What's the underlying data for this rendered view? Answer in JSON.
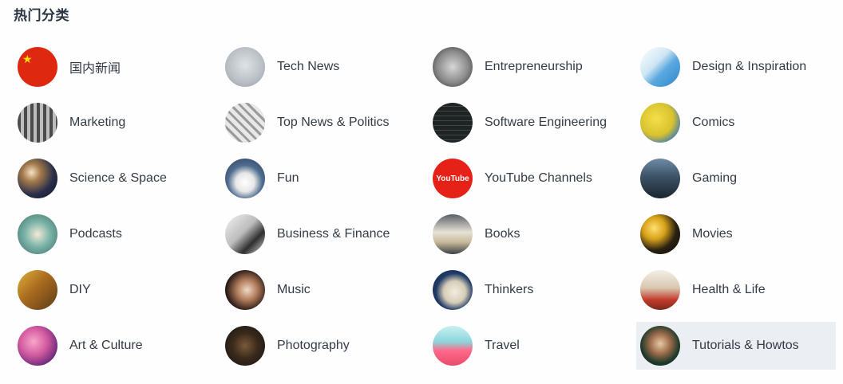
{
  "section_title": "热门分类",
  "categories": [
    {
      "label": "国内新闻",
      "icon": "china-flag-icon"
    },
    {
      "label": "Tech News",
      "icon": "robot-icon"
    },
    {
      "label": "Entrepreneurship",
      "icon": "mug-icon"
    },
    {
      "label": "Design & Inspiration",
      "icon": "design-icon"
    },
    {
      "label": "Marketing",
      "icon": "typewriter-icon"
    },
    {
      "label": "Top News & Politics",
      "icon": "newspaper-icon"
    },
    {
      "label": "Software Engineering",
      "icon": "code-icon"
    },
    {
      "label": "Comics",
      "icon": "comic-icon"
    },
    {
      "label": "Science & Space",
      "icon": "telescope-icon"
    },
    {
      "label": "Fun",
      "icon": "cat-icon"
    },
    {
      "label": "YouTube Channels",
      "icon": "youtube-icon"
    },
    {
      "label": "Gaming",
      "icon": "controller-icon"
    },
    {
      "label": "Podcasts",
      "icon": "microphone-icon"
    },
    {
      "label": "Business & Finance",
      "icon": "briefcase-icon"
    },
    {
      "label": "Books",
      "icon": "book-icon"
    },
    {
      "label": "Movies",
      "icon": "film-reel-icon"
    },
    {
      "label": "DIY",
      "icon": "tools-icon"
    },
    {
      "label": "Music",
      "icon": "headphones-icon"
    },
    {
      "label": "Thinkers",
      "icon": "statue-icon"
    },
    {
      "label": "Health & Life",
      "icon": "heart-icon"
    },
    {
      "label": "Art & Culture",
      "icon": "palette-icon"
    },
    {
      "label": "Photography",
      "icon": "camera-icon"
    },
    {
      "label": "Travel",
      "icon": "palm-tree-icon"
    },
    {
      "label": "Tutorials & Howtos",
      "icon": "glasses-icon"
    }
  ],
  "youtube_logo_text": "YouTube",
  "active_index": 23,
  "colors": {
    "title": "#2a3442",
    "label": "#333b46",
    "active_background": "#ebeef2"
  }
}
